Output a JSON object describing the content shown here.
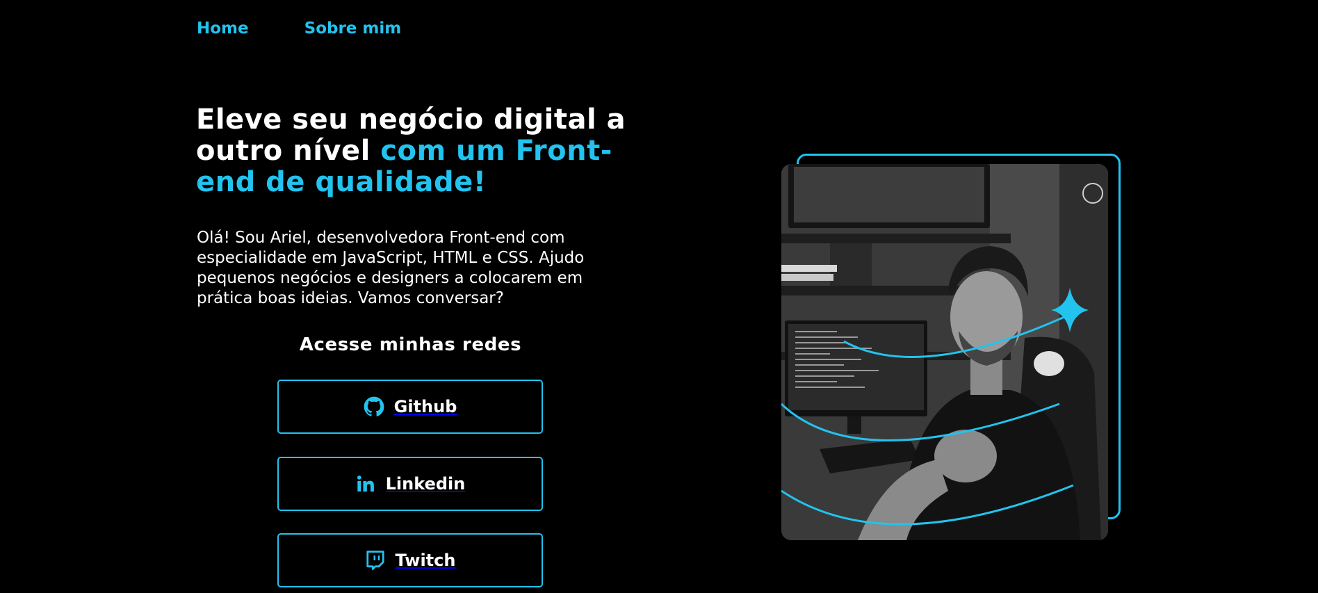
{
  "nav": {
    "home": "Home",
    "about": "Sobre mim"
  },
  "hero": {
    "headline_white": "Eleve seu negócio digital a outro nível ",
    "headline_accent": "com um Front-end de qualidade!",
    "intro": "Olá! Sou Ariel, desenvolvedora Front-end com especialidade em JavaScript, HTML e CSS. Ajudo pequenos negócios e designers a colocarem em prática boas ideias. Vamos conversar?"
  },
  "social": {
    "title": "Acesse minhas redes",
    "buttons": [
      {
        "label": "Github",
        "icon": "github-icon"
      },
      {
        "label": "Linkedin",
        "icon": "linkedin-icon"
      },
      {
        "label": "Twitch",
        "icon": "twitch-icon"
      }
    ]
  },
  "colors": {
    "background": "#000000",
    "accent": "#22c3ef",
    "text": "#ffffff"
  }
}
